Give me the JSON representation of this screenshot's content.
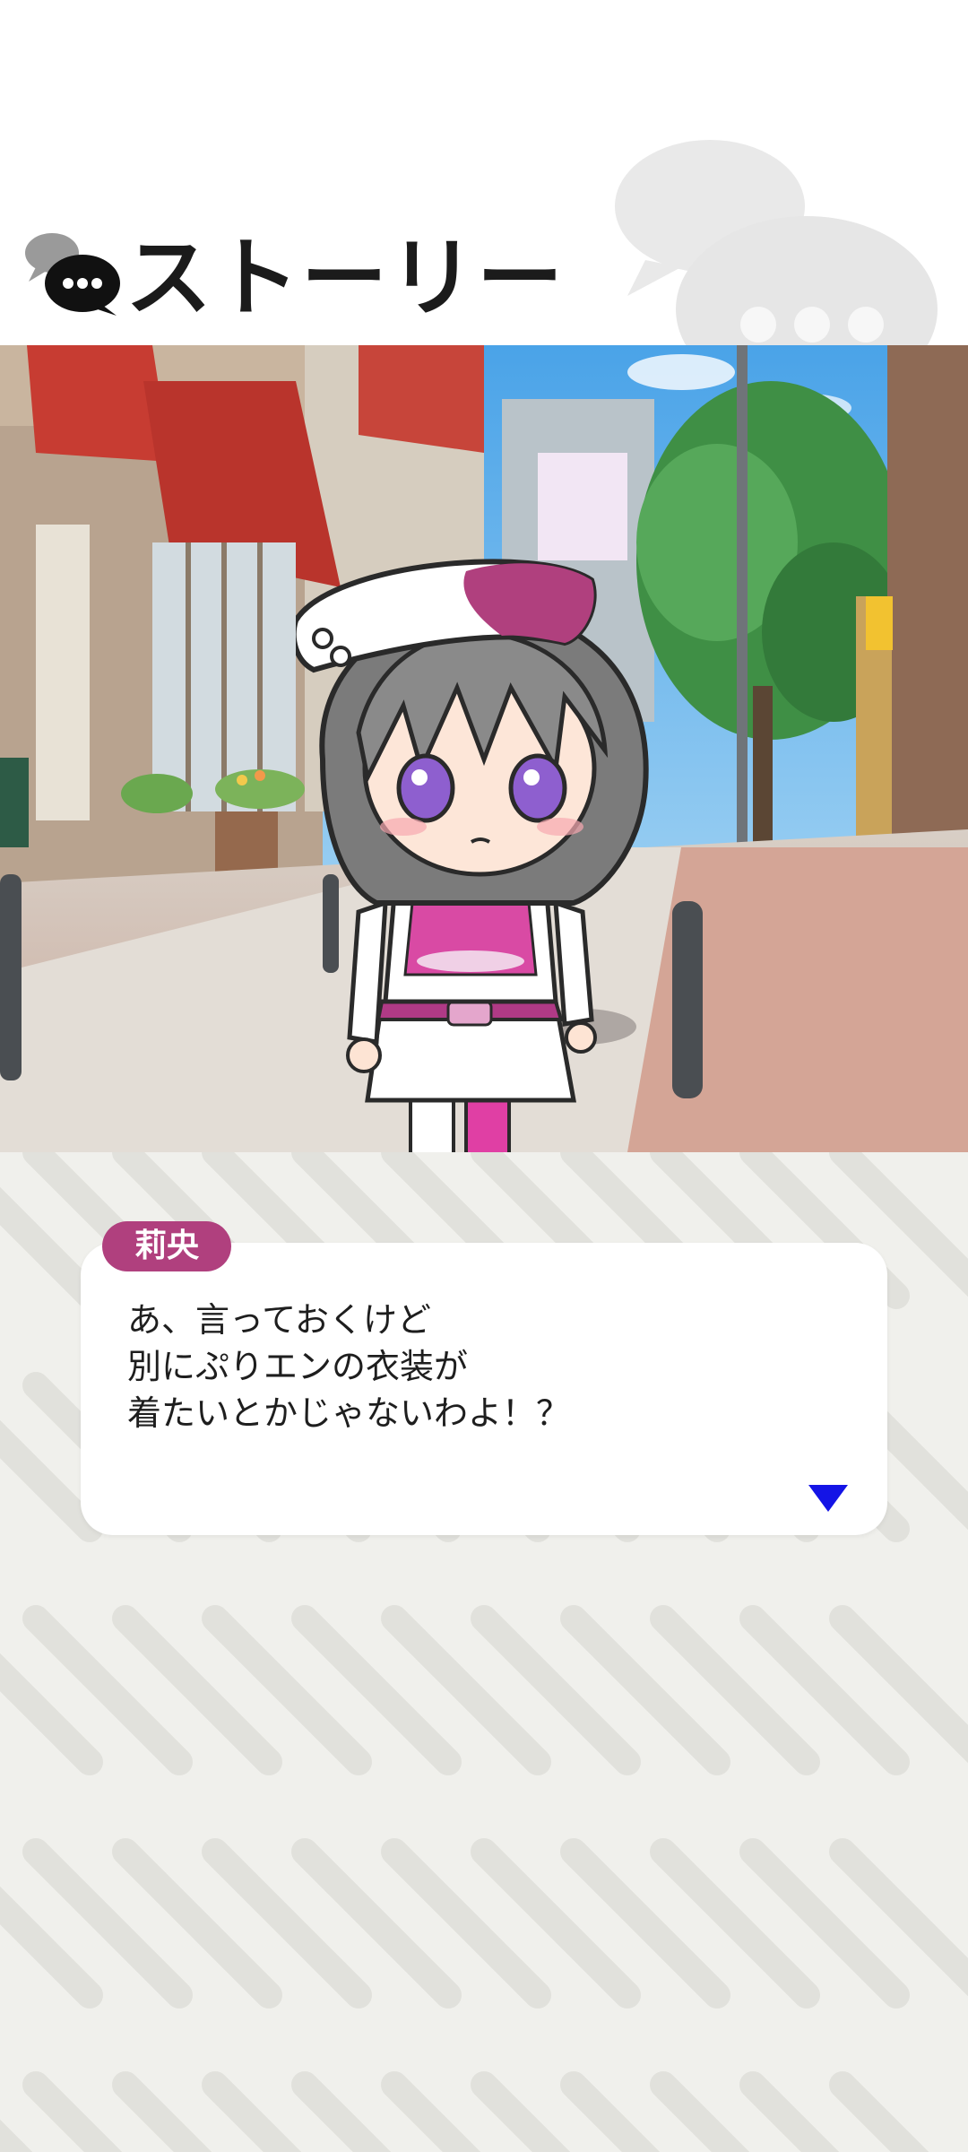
{
  "header": {
    "title": "ストーリー",
    "icon": "chat-bubble-icon"
  },
  "scene": {
    "background": "shopping-street",
    "character": "chibi-character-nurse-outfit"
  },
  "dialogue": {
    "speaker": "莉央",
    "lines": [
      "あ、言っておくけど",
      "別にぷりエンの衣装が",
      "着たいとかじゃないわよ！？"
    ],
    "advance_icon": "triangle-down-icon"
  },
  "colors": {
    "name_tag": "#b0407e",
    "advance_arrow": "#1414e6",
    "background": "#f0f0ec"
  }
}
